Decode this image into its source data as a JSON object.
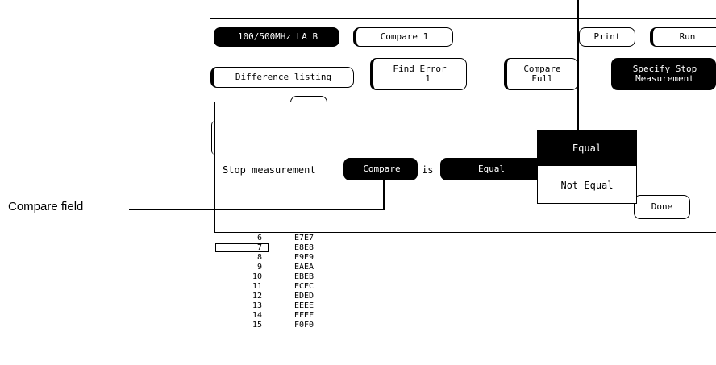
{
  "top_bar": {
    "module_label": "100/500MHz LA B",
    "menu_label": "Compare 1",
    "print_label": "Print",
    "run_label": "Run"
  },
  "second_bar": {
    "difference_listing_label": "Difference listing",
    "find_error_label": "Find Error",
    "find_error_value": "1",
    "compare_full_label": "Compare\nFull",
    "specify_stop_label": "Specify Stop\nMeasurement"
  },
  "dialog": {
    "stop_measurement_label": "Stop measurement",
    "compare_field_label": "Compare",
    "is_label": "is",
    "equal_field_label": "Equal",
    "done_label": "Done"
  },
  "popup": {
    "options": [
      "Equal",
      "Not Equal"
    ],
    "selected": "Equal"
  },
  "callouts": {
    "compare_field": "Compare field"
  },
  "listing": {
    "rows": [
      {
        "n": "6",
        "v": "E7E7"
      },
      {
        "n": "7",
        "v": "E8E8"
      },
      {
        "n": "8",
        "v": "E9E9"
      },
      {
        "n": "9",
        "v": "EAEA"
      },
      {
        "n": "10",
        "v": "EBEB"
      },
      {
        "n": "11",
        "v": "ECEC"
      },
      {
        "n": "12",
        "v": "EDED"
      },
      {
        "n": "13",
        "v": "EEEE"
      },
      {
        "n": "14",
        "v": "EFEF"
      },
      {
        "n": "15",
        "v": "F0F0"
      }
    ]
  }
}
